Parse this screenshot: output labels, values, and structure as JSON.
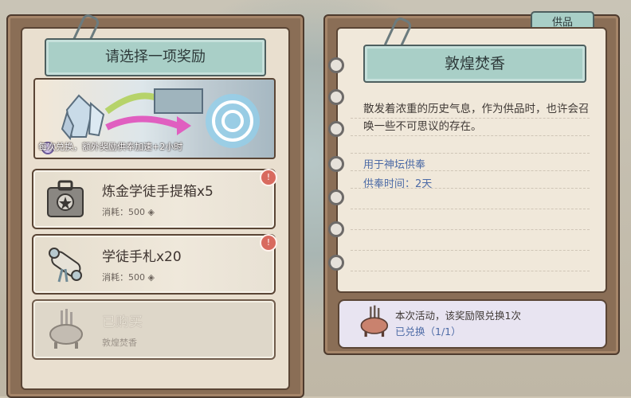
{
  "left_panel": {
    "banner_title": "请选择一项奖励",
    "art_caption": "每次兑换，额外奖励供奉加速+2小时",
    "cards": [
      {
        "title": "炼金学徒手提箱x5",
        "cost_label": "消耗：500",
        "alert": "!"
      },
      {
        "title": "学徒手札x20",
        "cost_label": "消耗：500",
        "alert": "!"
      },
      {
        "title": "已购买",
        "sub": "敦煌焚香"
      }
    ]
  },
  "right_panel": {
    "tab_label": "供品",
    "banner_title": "敦煌焚香",
    "description": "散发着浓重的历史气息，作为供品时，也许会召唤一些不可思议的存在。",
    "use_label": "用于神坛供奉",
    "time_label": "供奉时间：2天",
    "limit_text": "本次活动，该奖励限兑换1次",
    "exchanged_text": "已兑换（1/1）"
  },
  "colors": {
    "banner": "#a9cfc7",
    "paper": "#f0e8da",
    "frame": "#8a6e56",
    "link_blue": "#4d6ba6",
    "alert_red": "#d86a5e"
  },
  "icons": [
    "paperclip-icon",
    "crystal-icon",
    "portal-icon",
    "briefcase-icon",
    "scroll-icon",
    "incense-burner-icon",
    "coin-icon",
    "notebook-ring-icon"
  ]
}
